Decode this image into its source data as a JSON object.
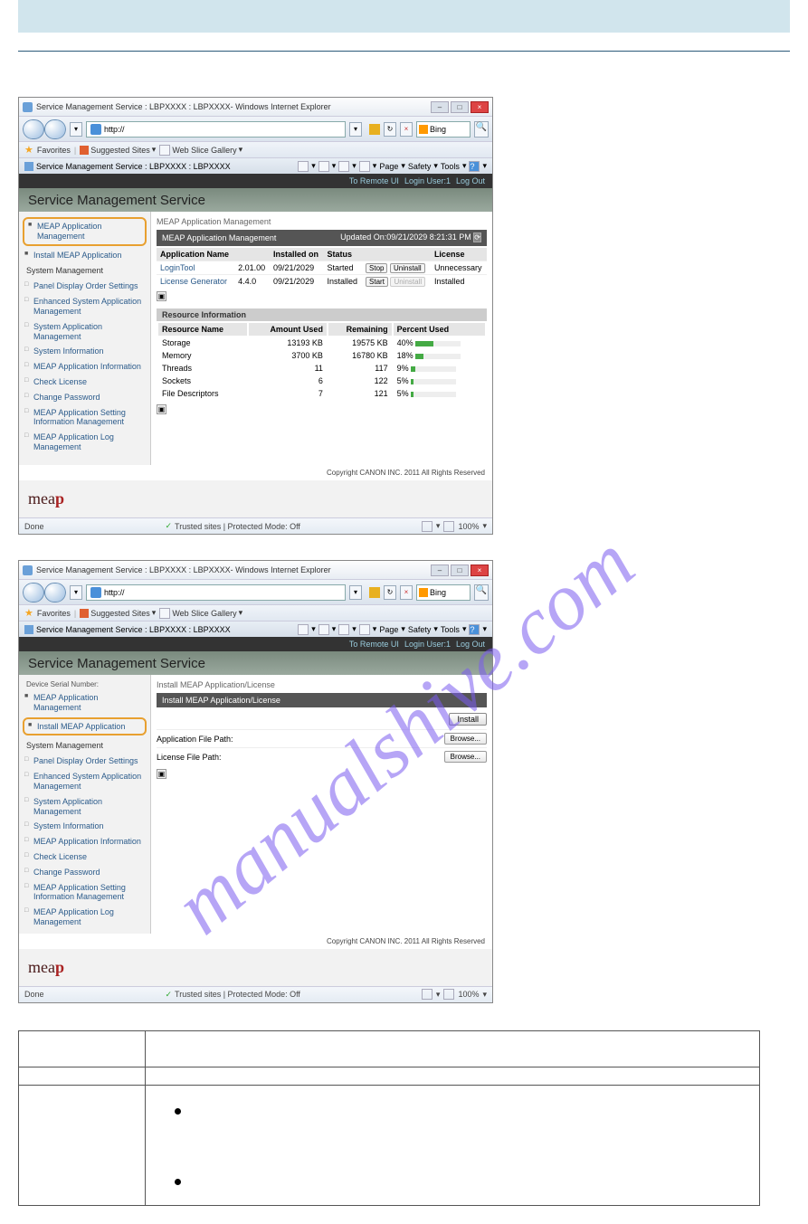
{
  "watermark": "manualshive.com",
  "browserTitle": "Service Management Service : LBPXXXX : LBPXXXX- Windows Internet Explorer",
  "urlText": "http://",
  "searchEngine": "Bing",
  "favoritesLabel": "Favorites",
  "suggestedSites": "Suggested Sites",
  "webSlice": "Web Slice Gallery",
  "tabTitle": "Service Management Service : LBPXXXX : LBPXXXX",
  "toolbar": {
    "page": "Page",
    "safety": "Safety",
    "tools": "Tools"
  },
  "topLinks": {
    "remote": "To Remote UI",
    "login": "Login User:1",
    "logout": "Log Out"
  },
  "pageHeader": "Service Management Service",
  "deviceSerial": "Device Serial Number:",
  "sidebarItems": {
    "meapMgmt": "MEAP Application Management",
    "installMeap": "Install MEAP Application",
    "sysMgmt": "System Management",
    "panelDisplay": "Panel Display Order Settings",
    "enhanced": "Enhanced System Application Management",
    "sysAppMgmt": "System Application Management",
    "sysInfo": "System Information",
    "meapAppInfo": "MEAP Application Information",
    "checkLicense": "Check License",
    "changePwd": "Change Password",
    "meapSetting": "MEAP Application Setting Information Management",
    "meapLog": "MEAP Application Log Management"
  },
  "crumb1": "MEAP Application Management",
  "darkbar1": "MEAP Application Management",
  "updated": "Updated On:09/21/2029 8:21:31 PM",
  "appsTable": {
    "headers": [
      "Application Name",
      "",
      "Installed on",
      "Status",
      "",
      "License"
    ],
    "rows": [
      {
        "name": "LoginTool",
        "ver": "2.01.00",
        "date": "09/21/2029",
        "status": "Started",
        "btn1": "Stop",
        "btn2": "Uninstall",
        "lic": "Unnecessary"
      },
      {
        "name": "License Generator",
        "ver": "4.4.0",
        "date": "09/21/2029",
        "status": "Installed",
        "btn1": "Start",
        "btn2": "Uninstall",
        "btn2disabled": true,
        "lic": "Installed"
      }
    ]
  },
  "resourceTitle": "Resource Information",
  "resTable": {
    "headers": [
      "Resource Name",
      "Amount Used",
      "Remaining",
      "Percent Used"
    ],
    "rows": [
      {
        "name": "Storage",
        "used": "13193 KB",
        "rem": "19575 KB",
        "pct": "40%",
        "bar": 40
      },
      {
        "name": "Memory",
        "used": "3700 KB",
        "rem": "16780 KB",
        "pct": "18%",
        "bar": 18
      },
      {
        "name": "Threads",
        "used": "11",
        "rem": "117",
        "pct": "9%",
        "bar": 9
      },
      {
        "name": "Sockets",
        "used": "6",
        "rem": "122",
        "pct": "5%",
        "bar": 5
      },
      {
        "name": "File Descriptors",
        "used": "7",
        "rem": "121",
        "pct": "5%",
        "bar": 5
      }
    ]
  },
  "copyright": "Copyright CANON INC. 2011 All Rights Reserved",
  "meapLogo": "mea",
  "meapLogoP": "p",
  "statusDone": "Done",
  "statusTrusted": "Trusted sites | Protected Mode: Off",
  "zoom": "100%",
  "crumb2": "Install MEAP Application/License",
  "darkbar2": "Install MEAP Application/License",
  "installBtn": "Install",
  "appFilePath": "Application File Path:",
  "licFilePath": "License File Path:",
  "browse": "Browse...",
  "docTable": {
    "r1h": "",
    "r1": "",
    "r2h": "",
    "r2": "",
    "r3h": ""
  }
}
